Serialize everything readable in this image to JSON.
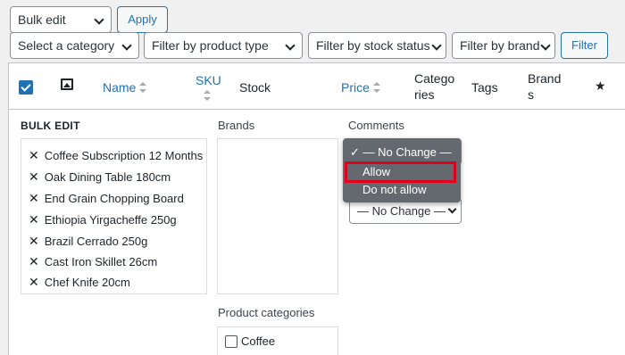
{
  "toolbar": {
    "bulk_action": "Bulk edit",
    "apply_label": "Apply",
    "category_filter": "Select a category",
    "product_type_filter": "Filter by product type",
    "stock_status_filter": "Filter by stock status",
    "brand_filter": "Filter by brand",
    "filter_label": "Filter"
  },
  "columns": {
    "name": "Name",
    "sku": "SKU",
    "stock": "Stock",
    "price": "Price",
    "categories_line1": "Catego",
    "categories_line2": "ries",
    "tags": "Tags",
    "brands_line1": "Brand",
    "brands_line2": "s",
    "featured_glyph": "★",
    "image_glyph": "🖾"
  },
  "bulk_edit": {
    "heading": "BULK EDIT",
    "products": [
      "Coffee Subscription 12 Months",
      "Oak Dining Table 180cm",
      "End Grain Chopping Board",
      "Ethiopia Yirgacheffe 250g",
      "Brazil Cerrado 250g",
      "Cast Iron Skillet 26cm",
      "Chef Knife 20cm"
    ],
    "remove_glyph": "✕",
    "brands_label": "Brands",
    "product_categories_label": "Product categories",
    "categories": [
      "Coffee"
    ],
    "comments_label": "Comments",
    "comments_options": [
      "✓ — No Change —",
      "Allow",
      "Do not allow"
    ],
    "second_select_value": "— No Change —"
  },
  "colors": {
    "accent": "#2271b1",
    "highlight": "#e0001b",
    "dropdown_bg": "#646970"
  }
}
